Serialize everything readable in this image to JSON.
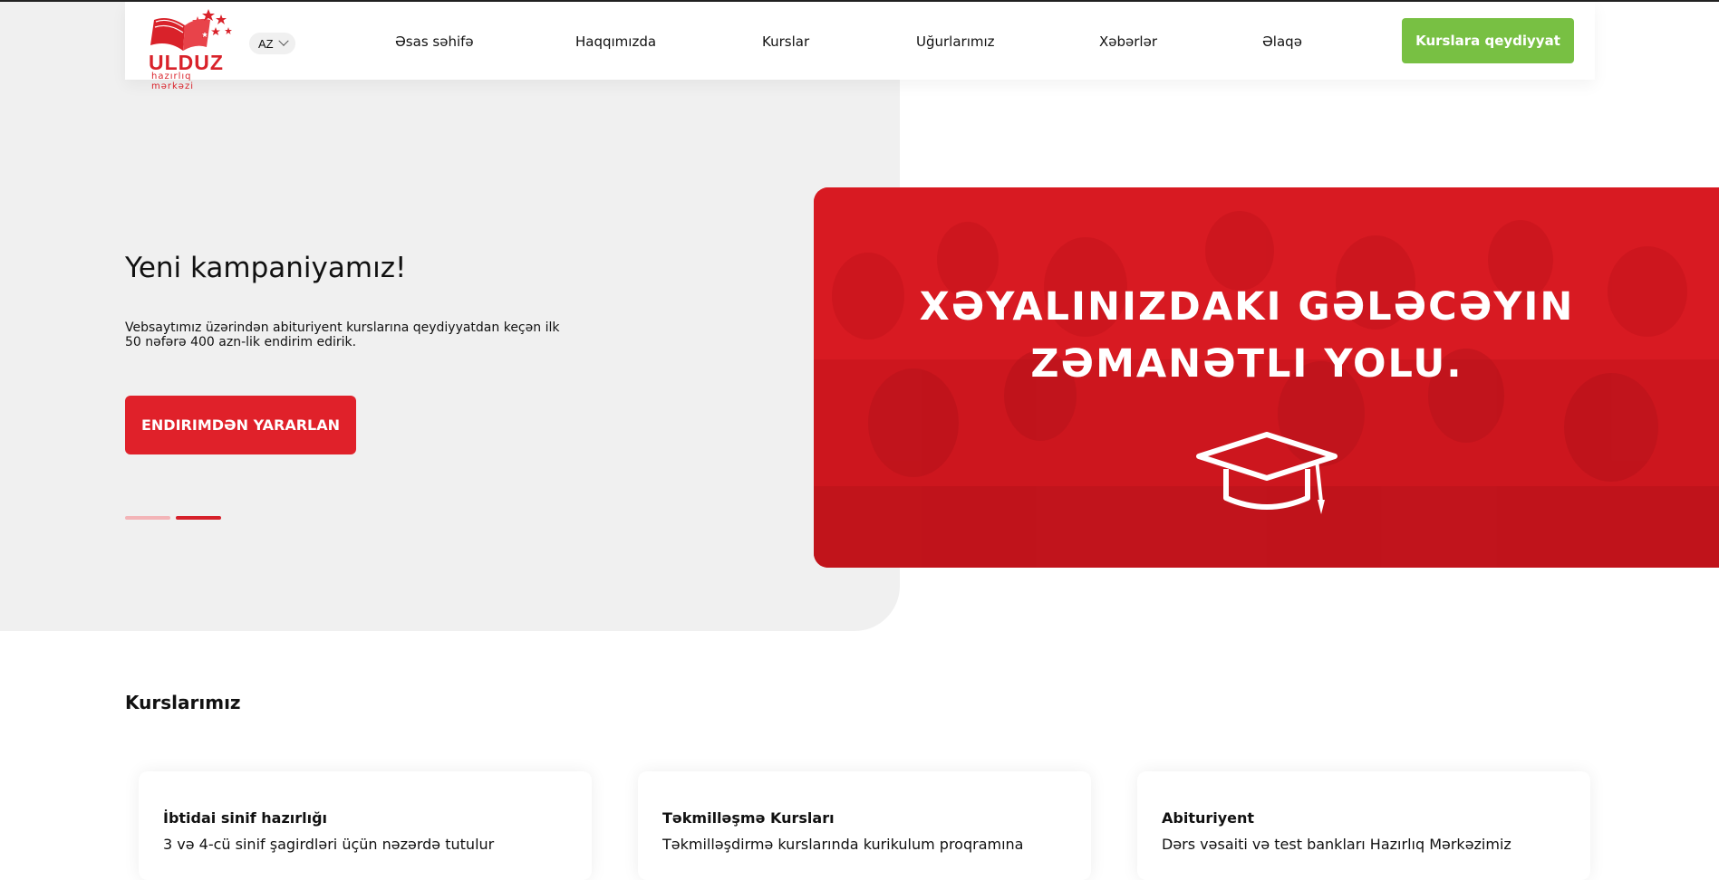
{
  "header": {
    "logo": {
      "name": "ULDUZ",
      "subtitle": "hazırlıq mərkəzi"
    },
    "language": "AZ",
    "nav": [
      "Əsas səhifə",
      "Haqqımızda",
      "Kurslar",
      "Uğurlarımız",
      "Xəbərlər",
      "Əlaqə"
    ],
    "cta_label": "Kurslara qeydiyyat"
  },
  "hero": {
    "title": "Yeni kampaniyamız!",
    "description": "Vebsaytımız üzərindən abituriyent kurslarına qeydiyyatdan keçən ilk 50 nəfərə 400 azn-lik endirim edirik.",
    "button_label": "ENDIRIMDƏN YARARLAN",
    "active_slide": 2,
    "slide_count": 2
  },
  "banner": {
    "line1": "XƏYALINIZDAKI GƏLƏCƏYIN",
    "line2": "ZƏMANƏTLI YOLU."
  },
  "courses": {
    "title": "Kurslarımız",
    "cards": [
      {
        "title": "İbtidai sinif hazırlığı",
        "desc": "3 və 4-cü sinif şagirdləri üçün nəzərdə tutulur"
      },
      {
        "title": "Təkmilləşmə Kursları",
        "desc": "Təkmilləşdirmə kurslarında kurikulum proqramına"
      },
      {
        "title": "Abituriyent",
        "desc": "Dərs vəsaiti və test bankları Hazırlıq Mərkəzimiz"
      }
    ]
  },
  "colors": {
    "brand_red": "#e0212a",
    "cta_green": "#78c043",
    "hero_bg": "#f0f0f0"
  }
}
